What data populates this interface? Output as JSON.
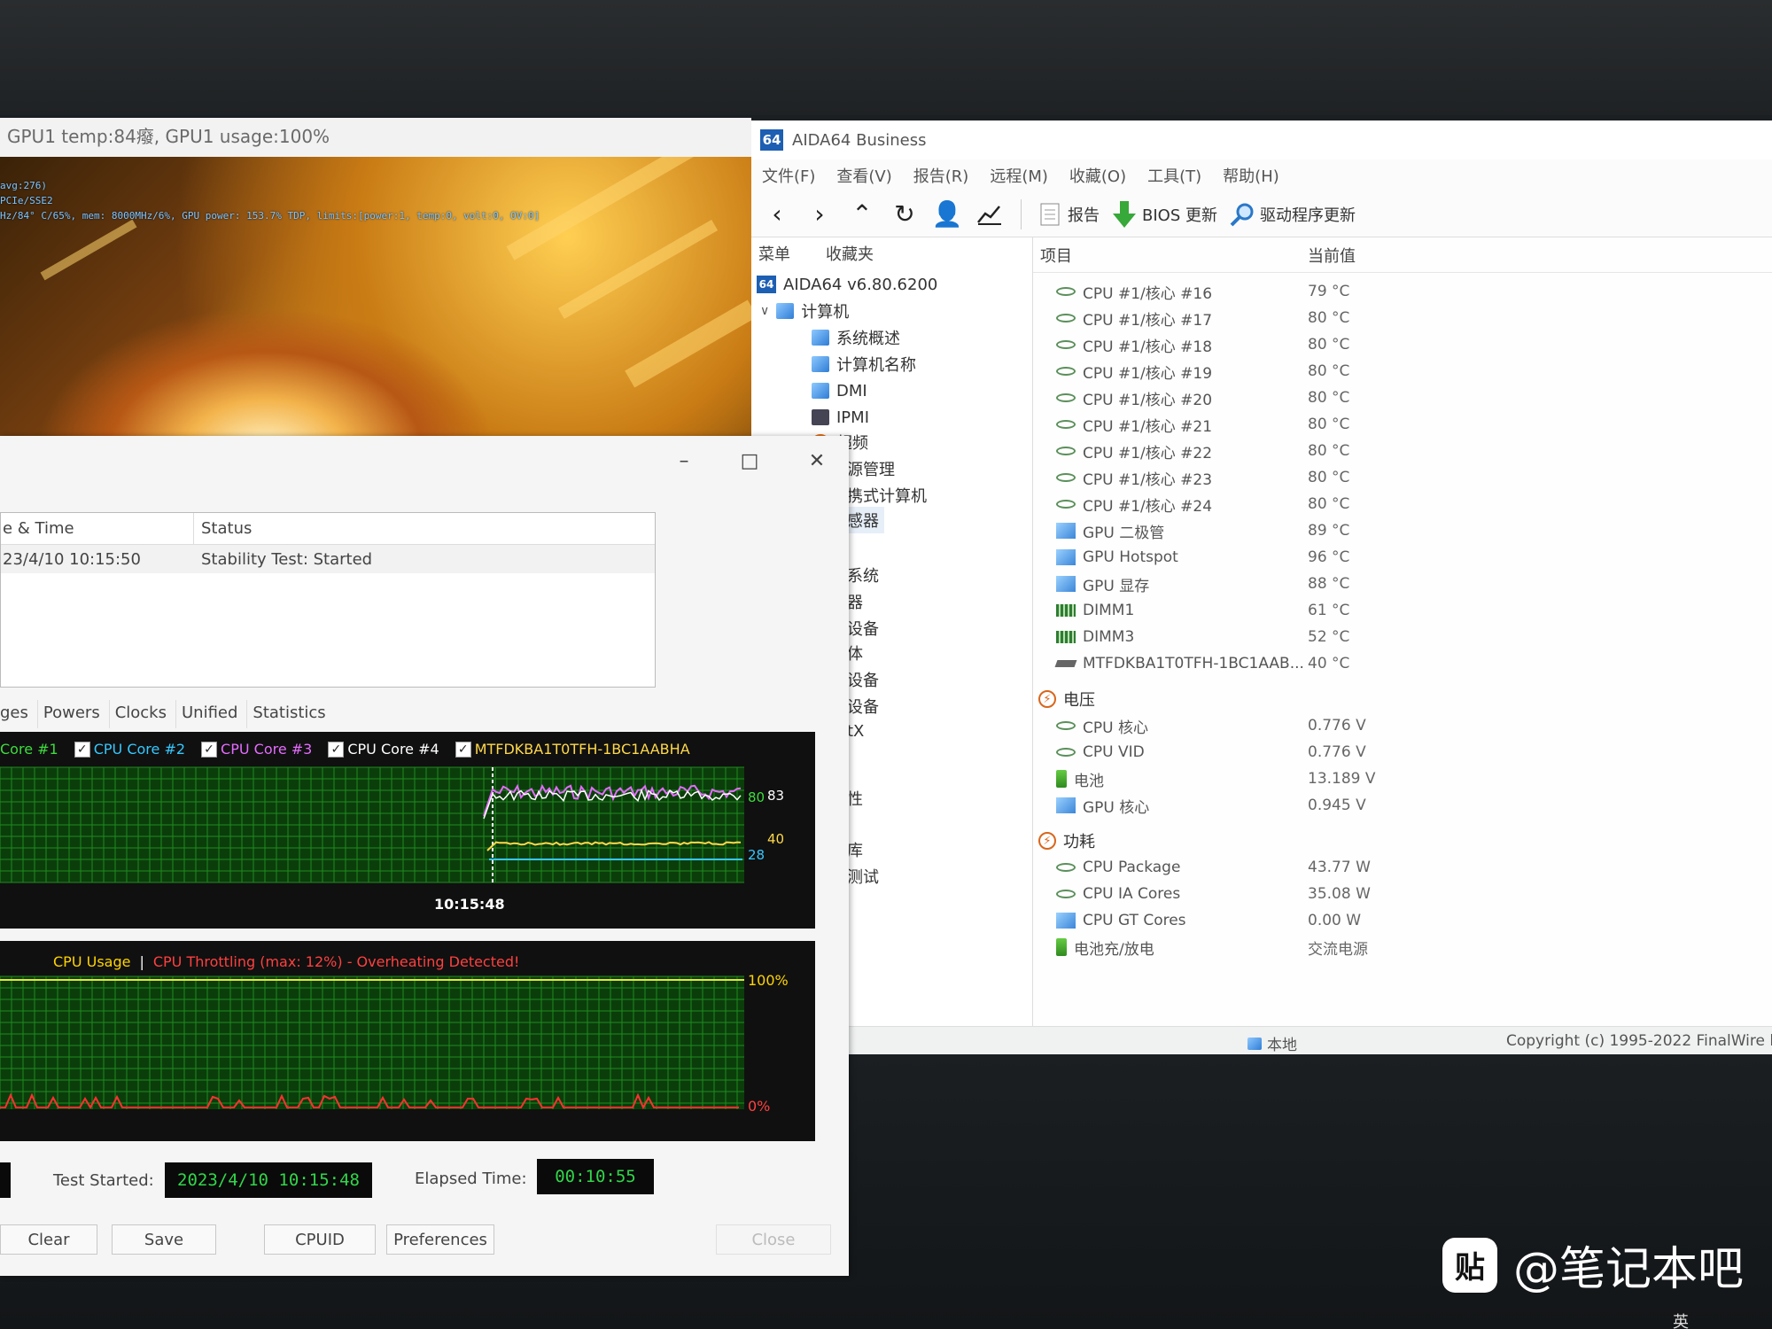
{
  "gpu_window": {
    "title": "GPU1 temp:84癈, GPU1 usage:100%",
    "overlay_lines": [
      "avg:276)",
      "PCIe/SSE2",
      "Hz/84° C/65%, mem: 8000MHz/6%, GPU power: 153.7% TDP, limits:[power:1, temp:0, volt:0, OV:0]"
    ]
  },
  "aida": {
    "title": "AIDA64 Business",
    "logo": "64",
    "menu": [
      "文件(F)",
      "查看(V)",
      "报告(R)",
      "远程(M)",
      "收藏(O)",
      "工具(T)",
      "帮助(H)"
    ],
    "toolbar": {
      "report": "报告",
      "bios_update": "BIOS 更新",
      "driver_update": "驱动程序更新"
    },
    "tree_tabs": [
      "菜单",
      "收藏夹"
    ],
    "tree": [
      {
        "label": "AIDA64 v6.80.6200"
      },
      {
        "label": "计算机"
      },
      {
        "label": "系统概述"
      },
      {
        "label": "计算机名称"
      },
      {
        "label": "DMI"
      },
      {
        "label": "IPMI"
      },
      {
        "label": "超频"
      },
      {
        "label": "源管理"
      },
      {
        "label": "携式计算机"
      },
      {
        "label": "感器"
      },
      {
        "label": "系统"
      },
      {
        "label": "器"
      },
      {
        "label": "设备"
      },
      {
        "label": "体"
      },
      {
        "label": "设备"
      },
      {
        "label": "设备"
      },
      {
        "label": "tX"
      },
      {
        "label": "性"
      },
      {
        "label": "库"
      },
      {
        "label": "测试"
      }
    ],
    "columns": {
      "item": "项目",
      "value": "当前值"
    },
    "temps": [
      {
        "name": "CPU #1/核心 #16",
        "value": "79 °C",
        "icon": "chip-icon"
      },
      {
        "name": "CPU #1/核心 #17",
        "value": "80 °C",
        "icon": "chip-icon"
      },
      {
        "name": "CPU #1/核心 #18",
        "value": "80 °C",
        "icon": "chip-icon"
      },
      {
        "name": "CPU #1/核心 #19",
        "value": "80 °C",
        "icon": "chip-icon"
      },
      {
        "name": "CPU #1/核心 #20",
        "value": "80 °C",
        "icon": "chip-icon"
      },
      {
        "name": "CPU #1/核心 #21",
        "value": "80 °C",
        "icon": "chip-icon"
      },
      {
        "name": "CPU #1/核心 #22",
        "value": "80 °C",
        "icon": "chip-icon"
      },
      {
        "name": "CPU #1/核心 #23",
        "value": "80 °C",
        "icon": "chip-icon"
      },
      {
        "name": "CPU #1/核心 #24",
        "value": "80 °C",
        "icon": "chip-icon"
      },
      {
        "name": "GPU 二极管",
        "value": "89 °C",
        "icon": "gpu-icon"
      },
      {
        "name": "GPU Hotspot",
        "value": "96 °C",
        "icon": "gpu-icon"
      },
      {
        "name": "GPU 显存",
        "value": "88 °C",
        "icon": "gpu-icon"
      },
      {
        "name": "DIMM1",
        "value": "61 °C",
        "icon": "ram-icon"
      },
      {
        "name": "DIMM3",
        "value": "52 °C",
        "icon": "ram-icon"
      },
      {
        "name": "MTFDKBA1T0TFH-1BC1AAB...",
        "value": "40 °C",
        "icon": "disk-icon"
      }
    ],
    "voltage_section": "电压",
    "voltages": [
      {
        "name": "CPU 核心",
        "value": "0.776 V",
        "icon": "chip-icon"
      },
      {
        "name": "CPU VID",
        "value": "0.776 V",
        "icon": "chip-icon"
      },
      {
        "name": "电池",
        "value": "13.189 V",
        "icon": "battery-icon"
      },
      {
        "name": "GPU 核心",
        "value": "0.945 V",
        "icon": "gpu-icon"
      }
    ],
    "power_section": "功耗",
    "powers": [
      {
        "name": "CPU Package",
        "value": "43.77 W",
        "icon": "chip-icon"
      },
      {
        "name": "CPU IA Cores",
        "value": "35.08 W",
        "icon": "chip-icon"
      },
      {
        "name": "CPU GT Cores",
        "value": "0.00 W",
        "icon": "gpu-icon"
      },
      {
        "name": "电池充/放电",
        "value": "交流电源",
        "icon": "battery-icon"
      }
    ],
    "status_local": "本地",
    "status_copyright": "Copyright (c) 1995-2022 FinalWire l"
  },
  "sst": {
    "log_headers": [
      "e & Time",
      "Status"
    ],
    "log_rows": [
      {
        "time": "23/4/10 10:15:50",
        "status": "Stability Test: Started"
      }
    ],
    "tabs": [
      "ges",
      "Powers",
      "Clocks",
      "Unified",
      "Statistics"
    ],
    "legend": [
      {
        "label": "Core #1",
        "color": "#3ddc3d",
        "checked": false
      },
      {
        "label": "CPU Core #2",
        "color": "#36c8ff",
        "checked": true
      },
      {
        "label": "CPU Core #3",
        "color": "#e46cff",
        "checked": true
      },
      {
        "label": "CPU Core #4",
        "color": "#ffffff",
        "checked": true
      },
      {
        "label": "MTFDKBA1T0TFH-1BC1AABHA",
        "color": "#ffd84a",
        "checked": true
      }
    ],
    "temp_labels": {
      "v80": "80",
      "v83": "83",
      "v40": "40",
      "v28": "28",
      "time": "10:15:48"
    },
    "usage_label": "CPU Usage",
    "usage_sep": "|",
    "throttle_label": "CPU Throttling (max: 12%) - Overheating Detected!",
    "usage_axis": {
      "top": "100%",
      "bottom": "0%"
    },
    "test_started_label": "Test Started:",
    "test_started_value": "2023/4/10 10:15:48",
    "elapsed_label": "Elapsed Time:",
    "elapsed_value": "00:10:55",
    "buttons": {
      "clear": "Clear",
      "save": "Save",
      "cpuid": "CPUID",
      "preferences": "Preferences",
      "close": "Close"
    },
    "colors": {
      "grid": "#1f8a1f",
      "grid_bg": "#0b3d0b",
      "usage_line": "#e6e63a",
      "throttle_line": "#ff3030",
      "throttle_text": "#ff4040",
      "usage_text": "#ffd400"
    }
  },
  "watermark": {
    "logo": "贴",
    "text": "@笔记本吧"
  },
  "taskbar_hint": "英"
}
